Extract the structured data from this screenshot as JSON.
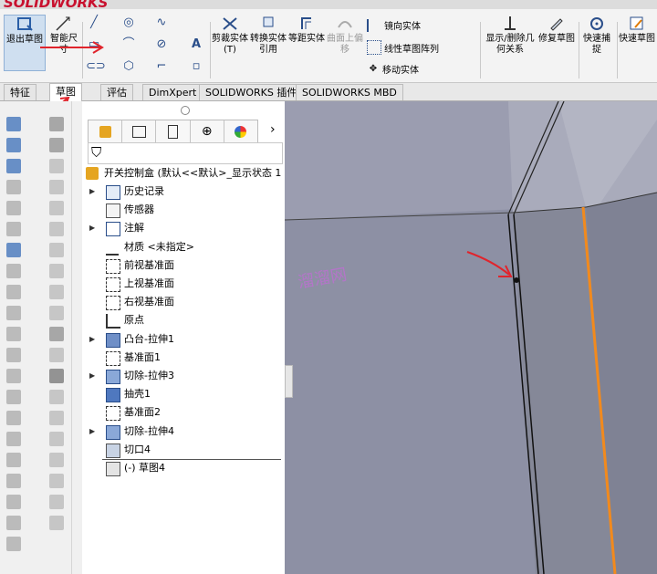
{
  "app": {
    "logo": "SOLIDWORKS"
  },
  "ribbon": {
    "exit_sketch": "退出草图",
    "smart_dim": "智能尺寸",
    "trim": "剪裁实体(T)",
    "convert": "转换实体引用",
    "offset": "等距实体",
    "surface_offset": "曲面上偏移",
    "mirror": "镜向实体",
    "linear_pattern": "线性草图阵列",
    "move": "移动实体",
    "relations": "显示/删除几何关系",
    "repair": "修复草图",
    "snap": "快速捕捉",
    "quick_sketch": "快速草图"
  },
  "tabs": [
    "特征",
    "草图",
    "评估",
    "DimXpert",
    "SOLIDWORKS 插件",
    "SOLIDWORKS MBD"
  ],
  "tree": {
    "root": "开关控制盒  (默认<<默认>_显示状态 1",
    "items": [
      {
        "label": "历史记录",
        "expander": true
      },
      {
        "label": "传感器",
        "expander": false
      },
      {
        "label": "注解",
        "expander": true
      },
      {
        "label": "材质 <未指定>",
        "expander": false
      },
      {
        "label": "前视基准面",
        "expander": false
      },
      {
        "label": "上视基准面",
        "expander": false
      },
      {
        "label": "右视基准面",
        "expander": false
      },
      {
        "label": "原点",
        "expander": false
      },
      {
        "label": "凸台-拉伸1",
        "expander": true
      },
      {
        "label": "基准面1",
        "expander": false
      },
      {
        "label": "切除-拉伸3",
        "expander": true
      },
      {
        "label": "抽壳1",
        "expander": false
      },
      {
        "label": "基准面2",
        "expander": false
      },
      {
        "label": "切除-拉伸4",
        "expander": true
      },
      {
        "label": "切口4",
        "expander": false
      },
      {
        "label": "(-) 草图4",
        "expander": false
      }
    ]
  },
  "watermark": "溜溜网",
  "colors": {
    "accent_orange": "#f28a1d",
    "viewport": "#8e91a5",
    "annotation_red": "#e0242c"
  }
}
